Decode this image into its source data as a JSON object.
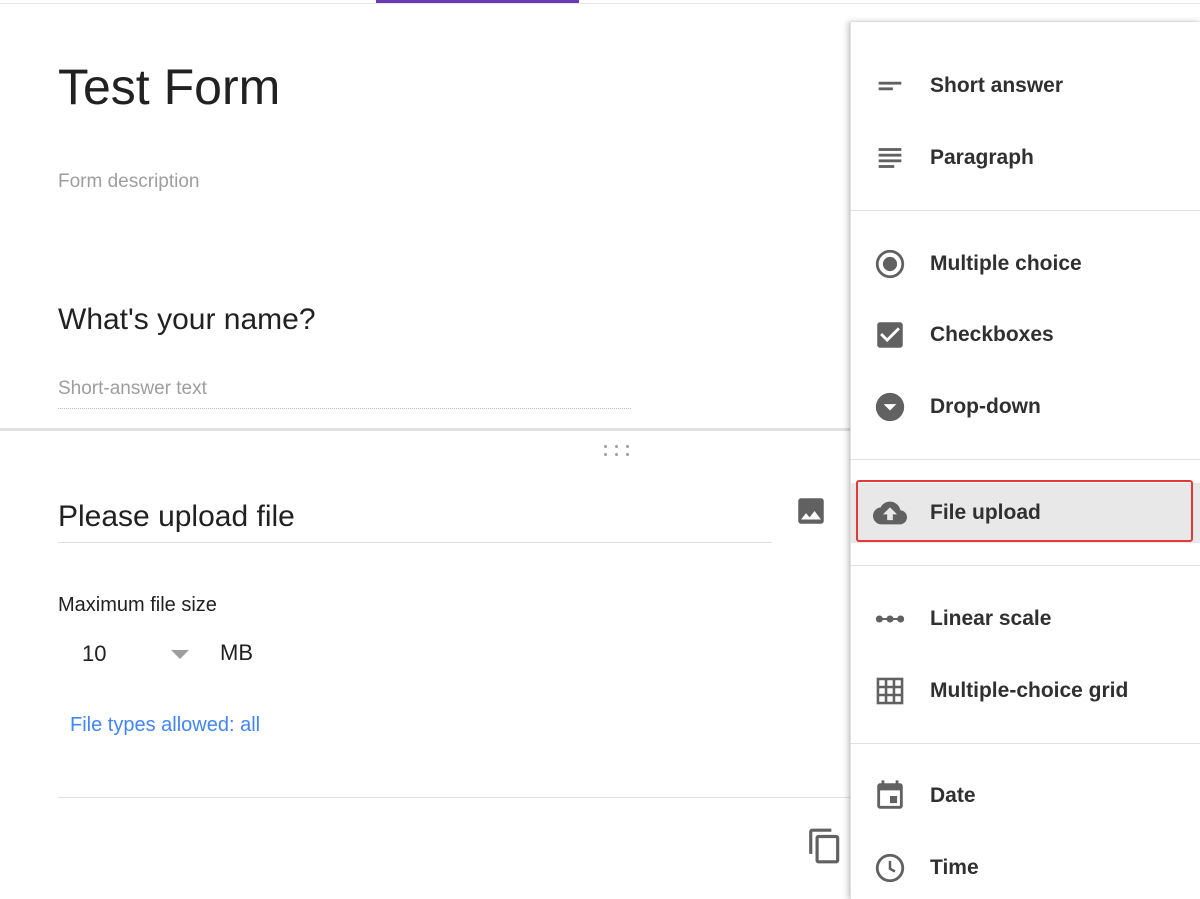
{
  "colors": {
    "accent": "#673ab7",
    "link": "#4285f4",
    "icon": "#616161",
    "highlight": "#e53935"
  },
  "form": {
    "title": "Test Form",
    "description_placeholder": "Form description"
  },
  "question1": {
    "title": "What's your name?",
    "answer_placeholder": "Short-answer text"
  },
  "question2": {
    "title": "Please upload file",
    "max_size_label": "Maximum file size",
    "max_size_value": "10",
    "unit": "MB",
    "file_types_link": "File types allowed: all"
  },
  "icons": {
    "drag": "drag-handle-icon",
    "image": "image-icon",
    "copy": "copy-icon"
  },
  "menu": {
    "selected": "File upload",
    "items": [
      {
        "label": "Short answer",
        "icon": "short-answer-icon"
      },
      {
        "label": "Paragraph",
        "icon": "paragraph-icon"
      },
      {
        "label": "Multiple choice",
        "icon": "radio-icon"
      },
      {
        "label": "Checkboxes",
        "icon": "checkbox-icon"
      },
      {
        "label": "Drop-down",
        "icon": "dropdown-icon"
      },
      {
        "label": "File upload",
        "icon": "cloud-upload-icon"
      },
      {
        "label": "Linear scale",
        "icon": "linear-scale-icon"
      },
      {
        "label": "Multiple-choice grid",
        "icon": "grid-icon"
      },
      {
        "label": "Date",
        "icon": "calendar-icon"
      },
      {
        "label": "Time",
        "icon": "clock-icon"
      }
    ]
  }
}
